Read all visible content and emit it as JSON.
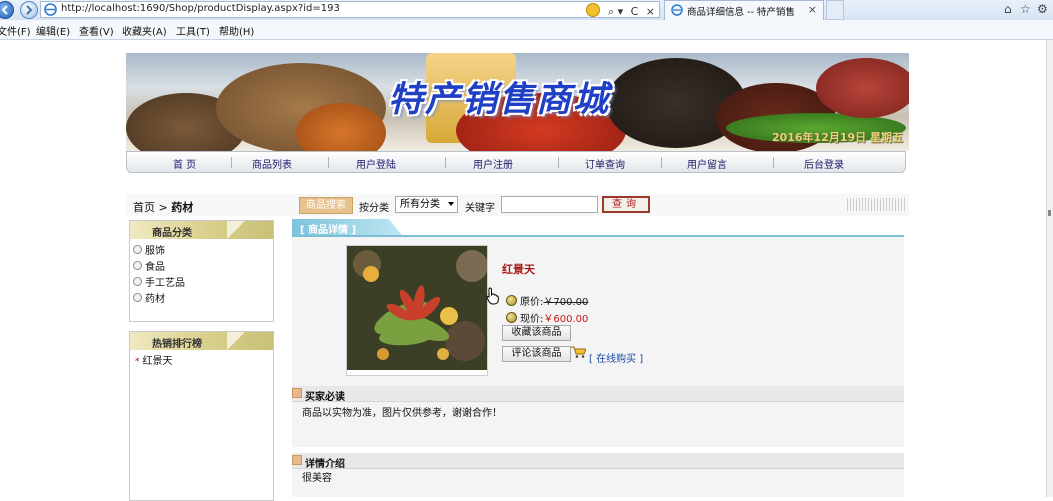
{
  "browser": {
    "url": "http://localhost:1690/Shop/productDisplay.aspx?id=193",
    "tab_title": "商品详细信息 -- 特产销售",
    "tab_close": "×",
    "addr_tools": [
      "⌕ ▾",
      "C",
      "×"
    ],
    "menu": [
      "文件(F)",
      "编辑(E)",
      "查看(V)",
      "收藏夹(A)",
      "工具(T)",
      "帮助(H)"
    ],
    "window_icons": [
      "⌂",
      "☆",
      "⚙"
    ]
  },
  "banner": {
    "title": "特产销售商城",
    "date_text": "2016年12月19日 星期五"
  },
  "nav": {
    "items": [
      "首 页",
      "商品列表",
      "用户登陆",
      "用户注册",
      "订单查询",
      "用户留言",
      "后台登录"
    ]
  },
  "search": {
    "breadcrumb_home": "首页",
    "breadcrumb_sep": ">",
    "breadcrumb_current": "药材",
    "badge": "商品搜索",
    "by_category_label": "按分类",
    "category_selected": "所有分类",
    "keyword_label": "关键字",
    "keyword_value": "",
    "query_button": "查询"
  },
  "sidebar": {
    "category_title": "商品分类",
    "categories": [
      "服饰",
      "食品",
      "手工艺品",
      "药材"
    ],
    "ranking_title": "热销排行榜",
    "ranking": [
      "红景天"
    ]
  },
  "product": {
    "section_title": "[ 商品详情 ]",
    "name": "红景天",
    "original_price_label": "原价:",
    "original_price": "￥700.00",
    "current_price_label": "现价:",
    "current_price": "￥600.00",
    "favorite_button": "收藏该商品",
    "comment_button": "评论该商品",
    "buy_link": "[ 在线购买 ]"
  },
  "notice": {
    "title": "买家必读",
    "text": "商品以实物为准，图片仅供参考，谢谢合作！"
  },
  "details": {
    "title": "详情介绍",
    "text": "很美容"
  },
  "colors": {
    "price_red": "#c01818",
    "nav_text": "#1a1a6a",
    "banner_title": "#1f3fc4",
    "panel_head": "#d8cf8a",
    "tab_blue": "#7cc3dc"
  }
}
